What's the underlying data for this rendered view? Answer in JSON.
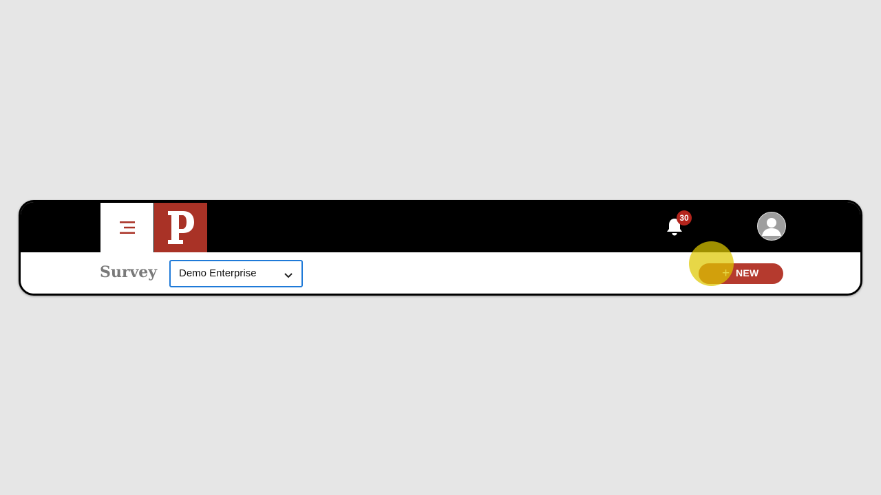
{
  "header": {
    "menu_icon": "menu-icon",
    "logo_letter": "P",
    "logo_color": "#a93226",
    "notifications": {
      "icon": "bell-icon",
      "count": "30",
      "badge_color": "#b3241c"
    },
    "user_icon": "user-avatar-icon"
  },
  "toolbar": {
    "title": "Survey",
    "enterprise_select": {
      "selected": "Demo Enterprise",
      "icon": "chevron-down-icon",
      "border_color": "#1f7ad8"
    },
    "new_button": {
      "icon": "plus-icon",
      "label": "NEW",
      "color": "#b53a2e"
    }
  },
  "cursor_highlight_color": "#dec800"
}
